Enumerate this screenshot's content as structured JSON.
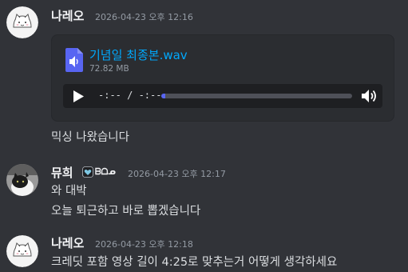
{
  "messages": [
    {
      "author": "나레오",
      "timestamp": "2026-04-23 오후 12:16",
      "avatar_icon": "cat-doodle-avatar",
      "attachment": {
        "file_name": "기념일 최종본.wav",
        "file_size": "72.82 MB",
        "file_icon": "audio-file-icon",
        "time_display": "-:-- / -:--",
        "progress": 0.02
      },
      "text": "믹싱 나왔습니다"
    },
    {
      "author": "뮤희",
      "badge_tag": "ᗷᗝᓄ",
      "timestamp": "2026-04-23 오후 12:17",
      "avatar_icon": "cat-photo-avatar",
      "lines": [
        "와 대박",
        "오늘 퇴근하고 바로 뽑겠습니다"
      ]
    },
    {
      "author": "나레오",
      "timestamp": "2026-04-23 오후 12:18",
      "avatar_icon": "cat-doodle-avatar",
      "text": "크레딧 포함 영상 길이 4:25로 맞추는거 어떻게 생각하세요"
    }
  ],
  "colors": {
    "background": "#313338",
    "card": "#2b2d31",
    "link": "#00a8fc",
    "accent": "#5865f2",
    "muted": "#949ba4"
  }
}
